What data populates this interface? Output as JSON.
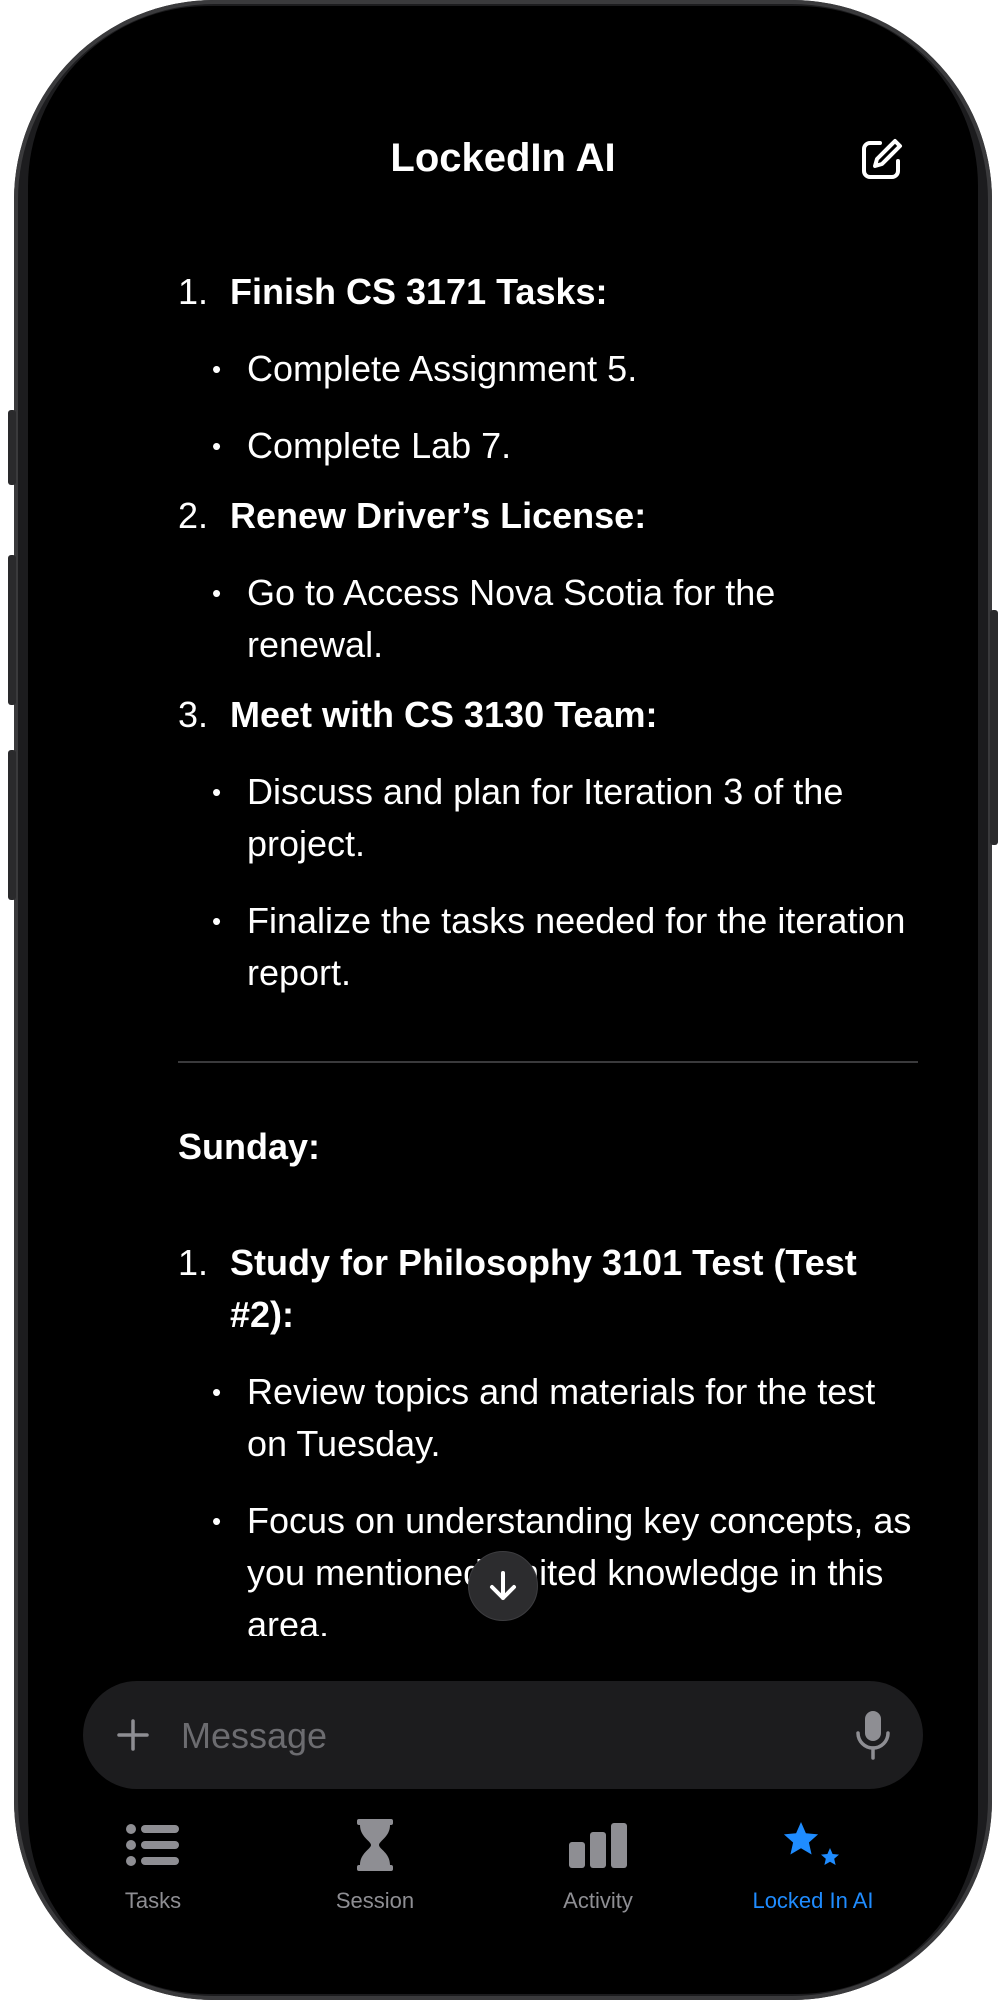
{
  "header": {
    "title": "LockedIn AI"
  },
  "chat": {
    "section1_items": [
      {
        "num": "1.",
        "title": "Finish CS 3171 Tasks:",
        "bullets": [
          "Complete Assignment 5.",
          "Complete Lab 7."
        ]
      },
      {
        "num": "2.",
        "title": "Renew Driver’s License:",
        "bullets": [
          "Go to Access Nova Scotia for the renewal."
        ]
      },
      {
        "num": "3.",
        "title": "Meet with CS 3130 Team:",
        "bullets": [
          "Discuss and plan for Iteration 3 of the project.",
          "Finalize the tasks needed for the iteration report."
        ]
      }
    ],
    "sunday_heading": "Sunday:",
    "sunday_items": [
      {
        "num": "1.",
        "title": "Study for Philosophy 3101 Test (Test #2):",
        "bullets": [
          "Review topics and materials for the test on Tuesday.",
          "Focus on understanding key concepts, as you mentioned limited knowledge in this area."
        ]
      }
    ]
  },
  "composer": {
    "placeholder": "Message"
  },
  "tabs": [
    {
      "label": "Tasks",
      "icon": "list-icon",
      "active": false
    },
    {
      "label": "Session",
      "icon": "hourglass-icon",
      "active": false
    },
    {
      "label": "Activity",
      "icon": "bar-chart-icon",
      "active": false
    },
    {
      "label": "Locked In AI",
      "icon": "stars-icon",
      "active": true
    }
  ],
  "colors": {
    "accent": "#1f8cff",
    "background": "#000000",
    "inactive": "#8e8e93"
  }
}
